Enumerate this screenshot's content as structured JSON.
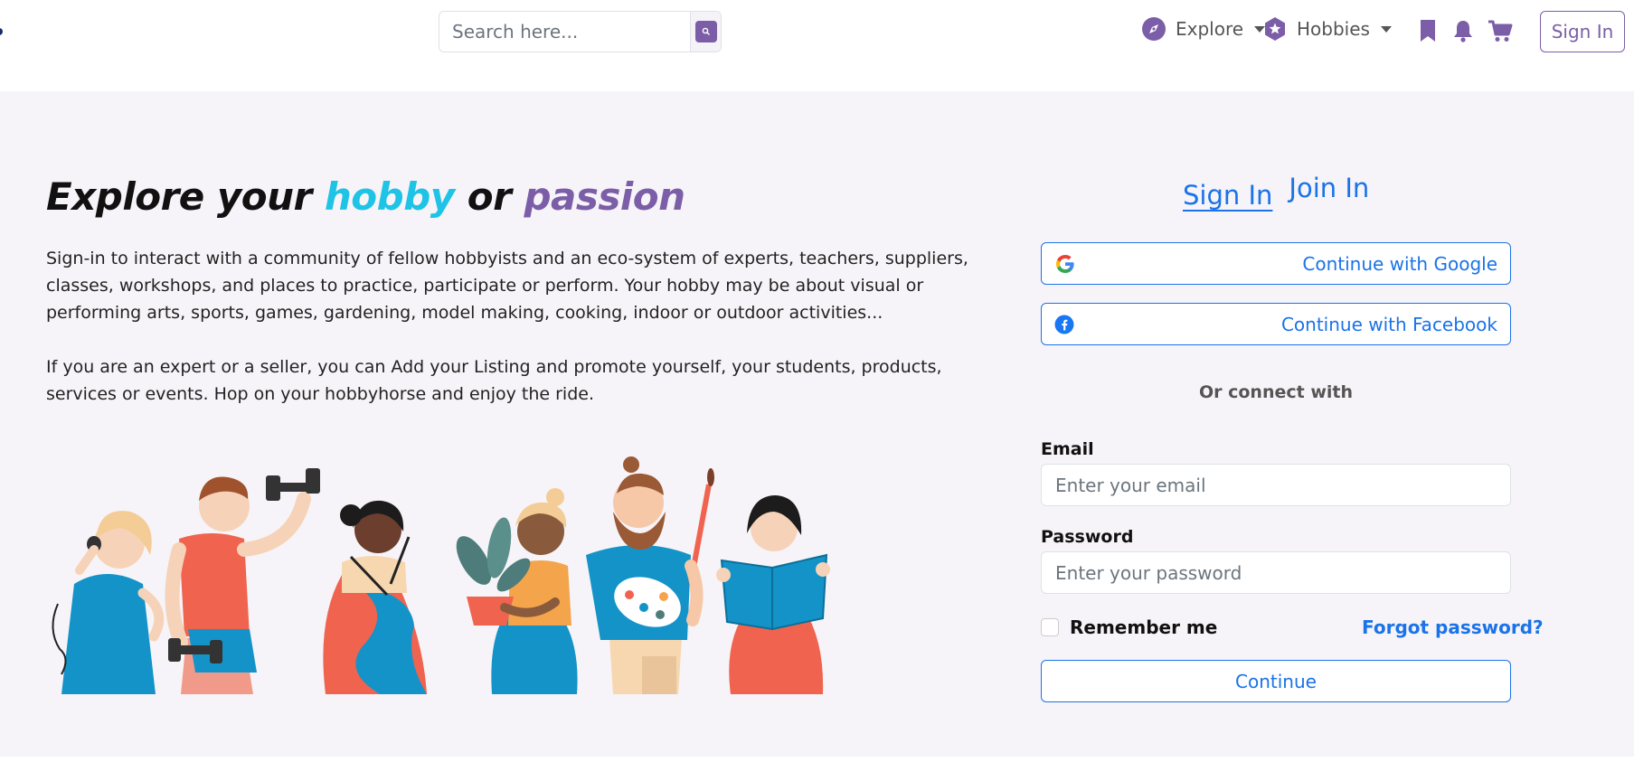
{
  "header": {
    "search": {
      "placeholder": "Search here...",
      "value": ""
    },
    "nav": [
      {
        "label": "Explore",
        "icon": "compass-icon"
      },
      {
        "label": "Hobbies",
        "icon": "star-badge-icon"
      }
    ],
    "icons": [
      "bookmark-icon",
      "bell-icon",
      "cart-icon"
    ],
    "sign_in_label": "Sign In",
    "accent_color": "#7b5ea7"
  },
  "hero": {
    "title_part1": "Explore your ",
    "title_hobby": "hobby",
    "title_part2": " or ",
    "title_passion": "passion",
    "paragraph1": "Sign-in to interact with a community of fellow hobbyists and an eco-system of experts, teachers, suppliers, classes, workshops, and places to practice, participate or perform. Your hobby may be about visual or performing arts, sports, games, gardening, model making, cooking, indoor or outdoor activities...",
    "paragraph2": "If you are an expert or a seller, you can Add your Listing and promote yourself, your students, products, services or events. Hop on your hobbyhorse and enjoy the ride.",
    "colors": {
      "hobby": "#1ec3e6",
      "passion": "#7b5ea7"
    }
  },
  "auth": {
    "tabs": {
      "sign_in": "Sign In",
      "join_in": "Join In"
    },
    "google_label": "Continue with Google",
    "facebook_label": "Continue with Facebook",
    "connect_text": "Or connect with",
    "email_label": "Email",
    "email_placeholder": "Enter your email",
    "password_label": "Password",
    "password_placeholder": "Enter your password",
    "remember_label": "Remember me",
    "forgot_label": "Forgot password?",
    "continue_label": "Continue",
    "link_color": "#1a73e8"
  }
}
